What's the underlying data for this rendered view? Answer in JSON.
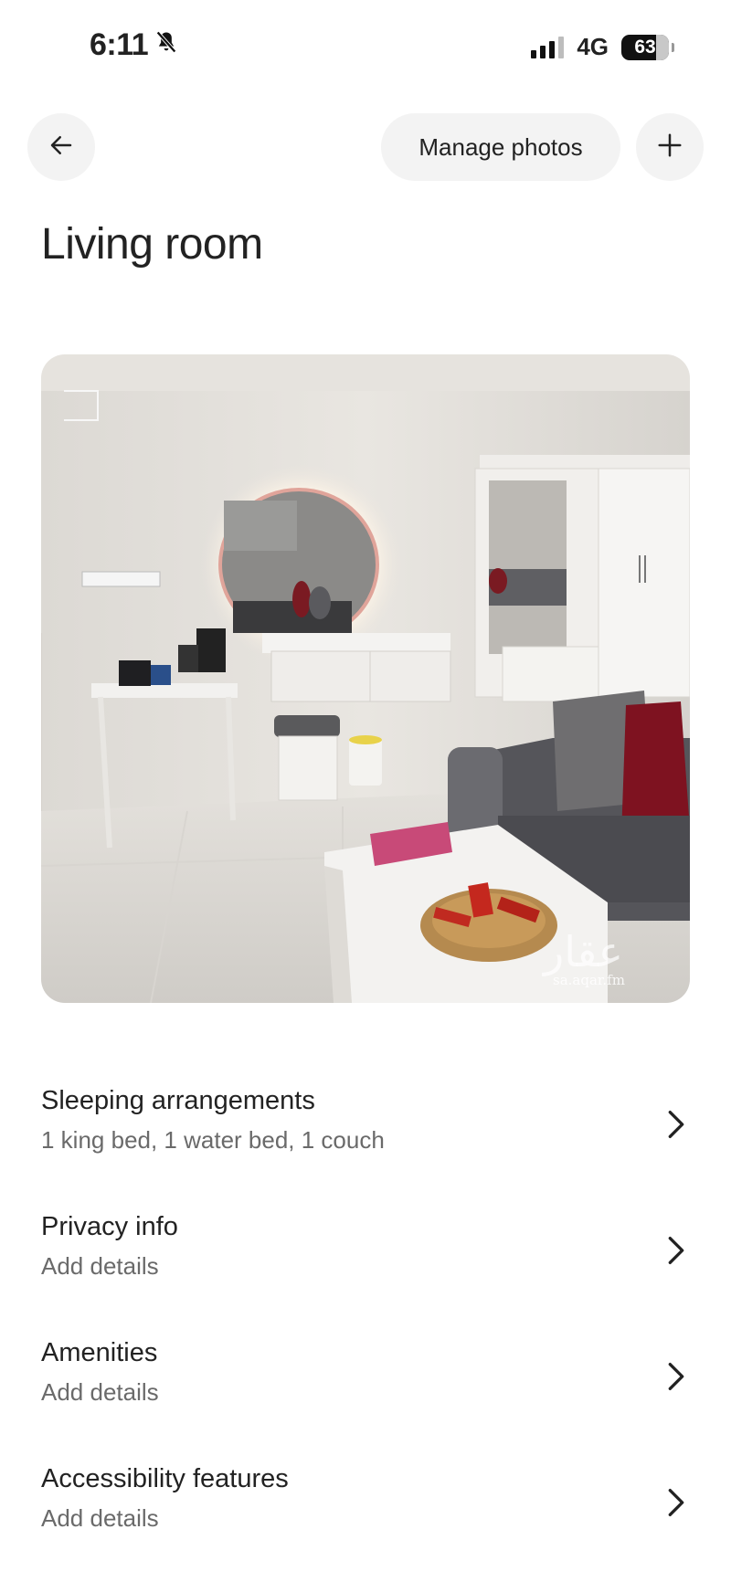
{
  "status_bar": {
    "time": "6:11",
    "network": "4G",
    "battery": "63",
    "icons": [
      "bell-slash-icon",
      "signal-icon",
      "battery-icon"
    ]
  },
  "header": {
    "back_icon": "arrow-left-icon",
    "manage_photos_label": "Manage photos",
    "add_icon": "plus-icon"
  },
  "page": {
    "title": "Living room"
  },
  "photo": {
    "watermark_script": "عقار",
    "watermark_url": "sa.aqar.fm"
  },
  "sections": [
    {
      "title": "Sleeping arrangements",
      "subtitle": "1 king bed, 1 water bed, 1 couch"
    },
    {
      "title": "Privacy info",
      "subtitle": "Add details"
    },
    {
      "title": "Amenities",
      "subtitle": "Add details"
    },
    {
      "title": "Accessibility features",
      "subtitle": "Add details"
    }
  ],
  "colors": {
    "text": "#222222",
    "subtext": "#6a6a6a",
    "button_bg": "#f3f3f3"
  }
}
